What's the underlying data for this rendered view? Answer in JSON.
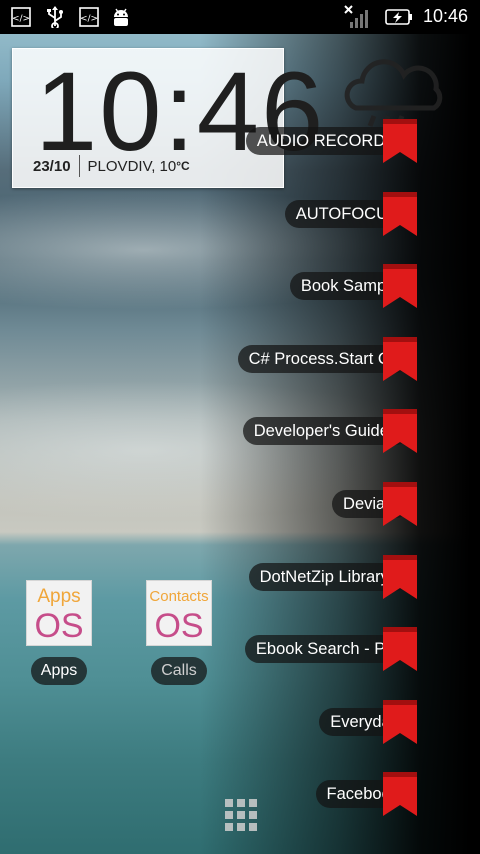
{
  "status_bar": {
    "left_icons": [
      "code-icon",
      "usb-icon",
      "code-icon",
      "android-icon"
    ],
    "right_icons": [
      "signal-off-icon",
      "battery-charging-icon"
    ],
    "time": "10:46"
  },
  "clock_widget": {
    "time": "10:46",
    "date": "23/10",
    "location": "PLOVDIV, 10",
    "temp_unit": "°C",
    "weather_icon": "rain-cloud-icon"
  },
  "bookmarks": [
    {
      "label": "AUDIO RECORD 1"
    },
    {
      "label": "AUTOFOCUS"
    },
    {
      "label": "Book Sample"
    },
    {
      "label": "C# Process.Start Co"
    },
    {
      "label": "Developer's Guide -"
    },
    {
      "label": "Deviant"
    },
    {
      "label": "DotNetZip Library -"
    },
    {
      "label": "Ebook Search - Pdf"
    },
    {
      "label": "Everyday"
    },
    {
      "label": "Facebook"
    }
  ],
  "apps": [
    {
      "tile_top": "Apps",
      "tile_bottom": "OS",
      "label": "Apps"
    },
    {
      "tile_top": "Contacts",
      "tile_bottom": "OS",
      "label": "Calls"
    }
  ],
  "dock": {
    "icon": "app-drawer-icon"
  },
  "colors": {
    "bookmark_red": "#e01b1b",
    "pill_bg": "#141414",
    "status_bar_bg": "#000000"
  }
}
